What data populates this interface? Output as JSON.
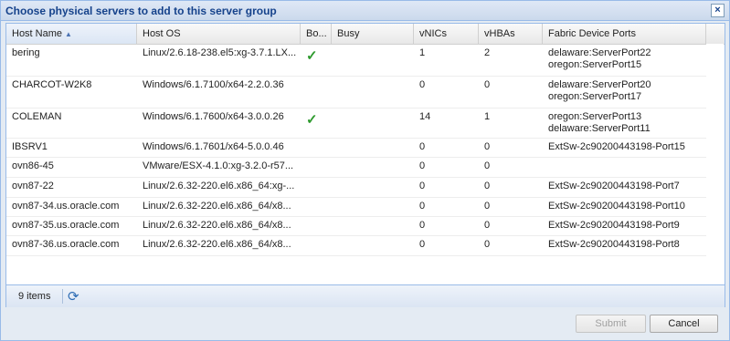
{
  "dialog": {
    "title": "Choose physical servers to add to this server group",
    "close_icon": "close-icon"
  },
  "grid": {
    "columns": [
      {
        "label": "Host Name",
        "sorted": "ascending"
      },
      {
        "label": "Host OS"
      },
      {
        "label": "Bo..."
      },
      {
        "label": "Busy"
      },
      {
        "label": "vNICs"
      },
      {
        "label": "vHBAs"
      },
      {
        "label": "Fabric Device Ports"
      }
    ],
    "rows": [
      {
        "host": "bering",
        "os": "Linux/2.6.18-238.el5:xg-3.7.1.LX...",
        "boot": true,
        "busy": "",
        "vnics": "1",
        "vhbas": "2",
        "ports": [
          "delaware:ServerPort22",
          "oregon:ServerPort15"
        ]
      },
      {
        "host": "CHARCOT-W2K8",
        "os": "Windows/6.1.7100/x64-2.2.0.36",
        "boot": false,
        "busy": "",
        "vnics": "0",
        "vhbas": "0",
        "ports": [
          "delaware:ServerPort20",
          "oregon:ServerPort17"
        ]
      },
      {
        "host": "COLEMAN",
        "os": "Windows/6.1.7600/x64-3.0.0.26",
        "boot": true,
        "busy": "",
        "vnics": "14",
        "vhbas": "1",
        "ports": [
          "oregon:ServerPort13",
          "delaware:ServerPort11"
        ]
      },
      {
        "host": "IBSRV1",
        "os": "Windows/6.1.7601/x64-5.0.0.46",
        "boot": false,
        "busy": "",
        "vnics": "0",
        "vhbas": "0",
        "ports": [
          "ExtSw-2c90200443198-Port15"
        ]
      },
      {
        "host": "ovn86-45",
        "os": "VMware/ESX-4.1.0:xg-3.2.0-r57...",
        "boot": false,
        "busy": "",
        "vnics": "0",
        "vhbas": "0",
        "ports": []
      },
      {
        "host": "ovn87-22",
        "os": "Linux/2.6.32-220.el6.x86_64:xg-...",
        "boot": false,
        "busy": "",
        "vnics": "0",
        "vhbas": "0",
        "ports": [
          "ExtSw-2c90200443198-Port7"
        ]
      },
      {
        "host": "ovn87-34.us.oracle.com",
        "os": "Linux/2.6.32-220.el6.x86_64/x8...",
        "boot": false,
        "busy": "",
        "vnics": "0",
        "vhbas": "0",
        "ports": [
          "ExtSw-2c90200443198-Port10"
        ]
      },
      {
        "host": "ovn87-35.us.oracle.com",
        "os": "Linux/2.6.32-220.el6.x86_64/x8...",
        "boot": false,
        "busy": "",
        "vnics": "0",
        "vhbas": "0",
        "ports": [
          "ExtSw-2c90200443198-Port9"
        ]
      },
      {
        "host": "ovn87-36.us.oracle.com",
        "os": "Linux/2.6.32-220.el6.x86_64/x8...",
        "boot": false,
        "busy": "",
        "vnics": "0",
        "vhbas": "0",
        "ports": [
          "ExtSw-2c90200443198-Port8"
        ]
      }
    ],
    "check_icon": "checkmark-icon"
  },
  "footer": {
    "items_text": "9 items",
    "refresh_icon": "refresh-icon"
  },
  "buttons": {
    "submit": "Submit",
    "cancel": "Cancel"
  },
  "colors": {
    "title_text": "#15428b",
    "border": "#99bbe8",
    "check": "#2e9a2e"
  }
}
